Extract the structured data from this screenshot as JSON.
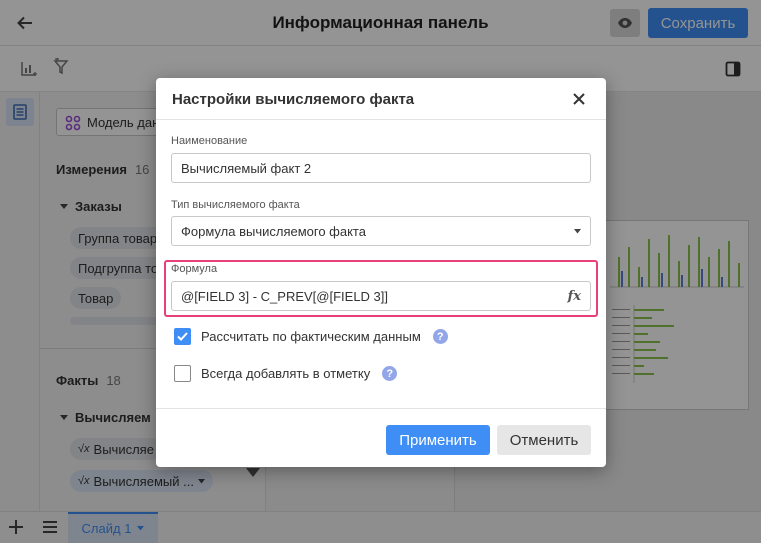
{
  "header": {
    "title": "Информационная панель",
    "save_label": "Сохранить"
  },
  "data_panel": {
    "model_label": "Модель дан",
    "dimensions_title": "Измерения",
    "dimensions_count": "16",
    "orders_group": "Заказы",
    "dimension_items": [
      "Группа товар",
      "Подгруппа то",
      "Товар"
    ],
    "facts_title": "Факты",
    "facts_count": "18",
    "calc_group": "Вычисляем",
    "fact_items": [
      "Вычисляе",
      "Вычисляемый ..."
    ]
  },
  "footer": {
    "slide_tab": "Слайд 1"
  },
  "dialog": {
    "title": "Настройки вычисляемого факта",
    "name_label": "Наименование",
    "name_value": "Вычисляемый факт 2",
    "type_label": "Тип вычисляемого факта",
    "type_value": "Формула вычисляемого факта",
    "formula_label": "Формула",
    "formula_value": "@[FIELD 3] - C_PREV[@[FIELD 3]]",
    "fx_label": "fx",
    "checkbox_actual_label": "Рассчитать по фактическим данным",
    "checkbox_actual_checked": true,
    "checkbox_mark_label": "Всегда добавлять в отметку",
    "checkbox_mark_checked": false,
    "help_glyph": "?",
    "apply_label": "Применить",
    "cancel_label": "Отменить"
  },
  "colors": {
    "accent": "#3f8ef5",
    "highlight": "#e8407b",
    "help": "#93a7e8",
    "chip": "#e1e4e8"
  }
}
